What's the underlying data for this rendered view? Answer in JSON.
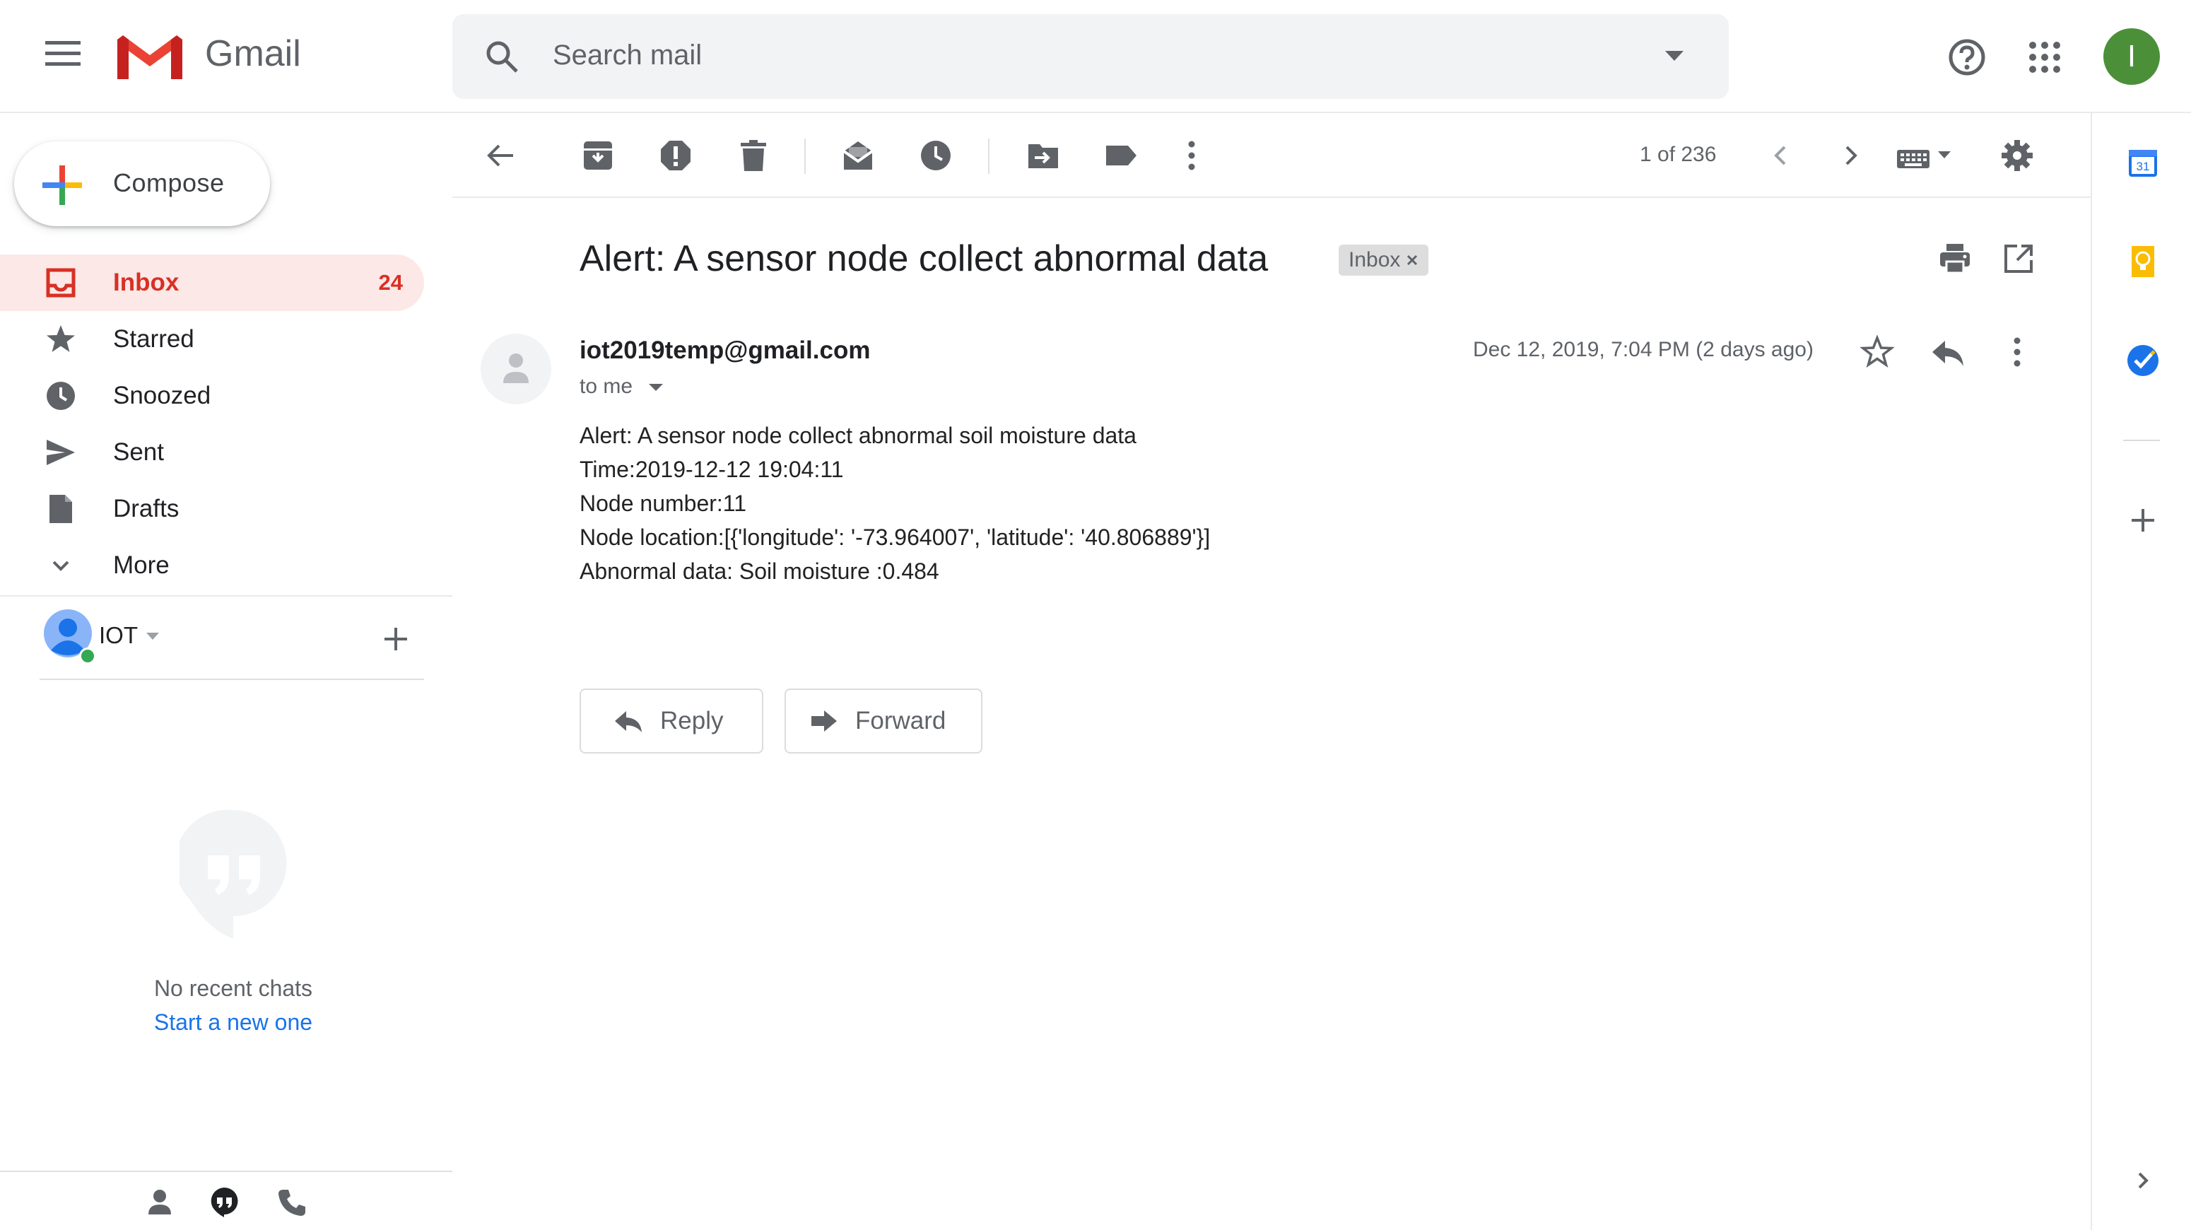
{
  "header": {
    "app_name": "Gmail",
    "search_placeholder": "Search mail",
    "user_initial": "I"
  },
  "sidebar": {
    "compose_label": "Compose",
    "items": [
      {
        "label": "Inbox",
        "count": "24",
        "icon": "inbox-icon"
      },
      {
        "label": "Starred",
        "icon": "star-icon"
      },
      {
        "label": "Snoozed",
        "icon": "clock-icon"
      },
      {
        "label": "Sent",
        "icon": "send-icon"
      },
      {
        "label": "Drafts",
        "icon": "draft-icon"
      },
      {
        "label": "More",
        "icon": "chevron-down-icon"
      }
    ]
  },
  "hangouts": {
    "user_name": "IOT",
    "no_chats_text": "No recent chats",
    "start_new_text": "Start a new one"
  },
  "toolbar": {
    "pager_text": "1 of 236"
  },
  "message": {
    "subject": "Alert: A sensor node collect abnormal data",
    "label_chip": "Inbox",
    "sender": "iot2019temp@gmail.com",
    "recipient": "to me",
    "date": "Dec 12, 2019, 7:04 PM (2 days ago)",
    "body_lines": [
      "Alert: A sensor node collect abnormal soil moisture data",
      "Time:2019-12-12 19:04:11",
      "Node number:11",
      "Node location:[{'longitude': '-73.964007', 'latitude': '40.806889'}]",
      "Abnormal data: Soil moisture :0.484"
    ],
    "reply_label": "Reply",
    "forward_label": "Forward"
  },
  "right_rail": {
    "calendar_date": "31"
  },
  "colors": {
    "accent_red": "#d93025",
    "inbox_highlight": "#fce8e6",
    "avatar_green": "#4c8f39",
    "link_blue": "#1a73e8"
  }
}
